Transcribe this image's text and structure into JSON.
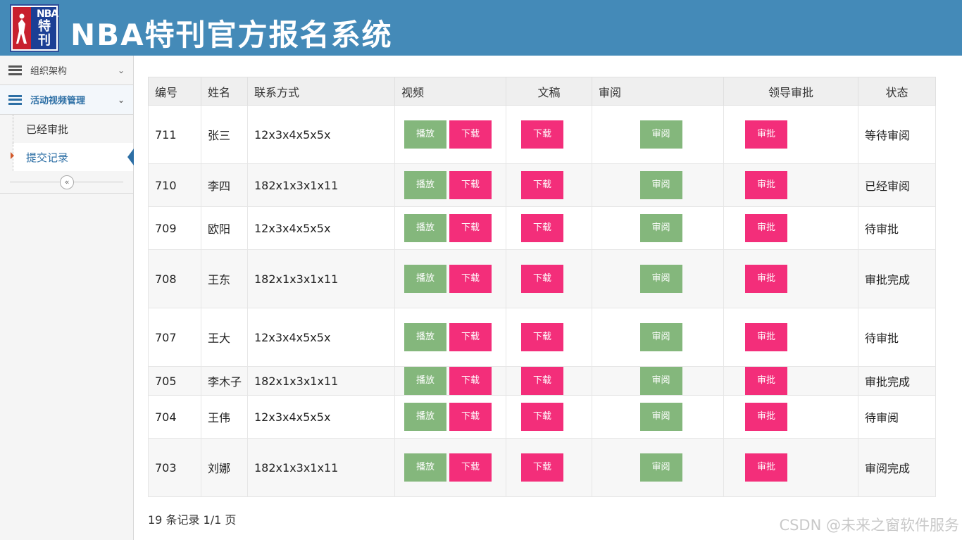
{
  "header": {
    "title": "NBA特刊官方报名系统",
    "logo_text_top": "NBA",
    "logo_text_main": "特刊"
  },
  "sidebar": {
    "groups": [
      {
        "label": "组织架构",
        "icon": "list-icon"
      },
      {
        "label": "活动视频管理",
        "icon": "list-icon",
        "active": true
      }
    ],
    "items": [
      {
        "label": "已经审批"
      },
      {
        "label": "提交记录",
        "current": true
      }
    ],
    "collapse_glyph": "«"
  },
  "table": {
    "headers": [
      "编号",
      "姓名",
      "联系方式",
      "视频",
      "文稿",
      "审阅",
      "领导审批",
      "状态"
    ],
    "buttons": {
      "play": "播放",
      "download": "下载",
      "review": "审阅",
      "approve": "审批"
    },
    "rows": [
      {
        "id": "711",
        "name": "张三",
        "contact": "12x3x4x5x5x",
        "status": "等待审阅"
      },
      {
        "id": "710",
        "name": "李四",
        "contact": "182x1x3x1x11",
        "status": "已经审阅"
      },
      {
        "id": "709",
        "name": "欧阳",
        "contact": "12x3x4x5x5x",
        "status": "待审批"
      },
      {
        "id": "708",
        "name": "王东",
        "contact": "182x1x3x1x11",
        "status": "审批完成"
      },
      {
        "id": "707",
        "name": "王大",
        "contact": "12x3x4x5x5x",
        "status": "待审批"
      },
      {
        "id": "705",
        "name": "李木子",
        "contact": "182x1x3x1x11",
        "status": "审批完成"
      },
      {
        "id": "704",
        "name": "王伟",
        "contact": "12x3x4x5x5x",
        "status": "待审阅"
      },
      {
        "id": "703",
        "name": "刘娜",
        "contact": "182x1x3x1x11",
        "status": "审阅完成"
      }
    ]
  },
  "pagination": {
    "summary": "19 条记录 1/1 页"
  },
  "watermark": "CSDN @未来之窗软件服务",
  "colors": {
    "header": "#448ab8",
    "green_button": "#84b77c",
    "pink_button": "#f32e7a",
    "accent": "#2d6fa5"
  }
}
